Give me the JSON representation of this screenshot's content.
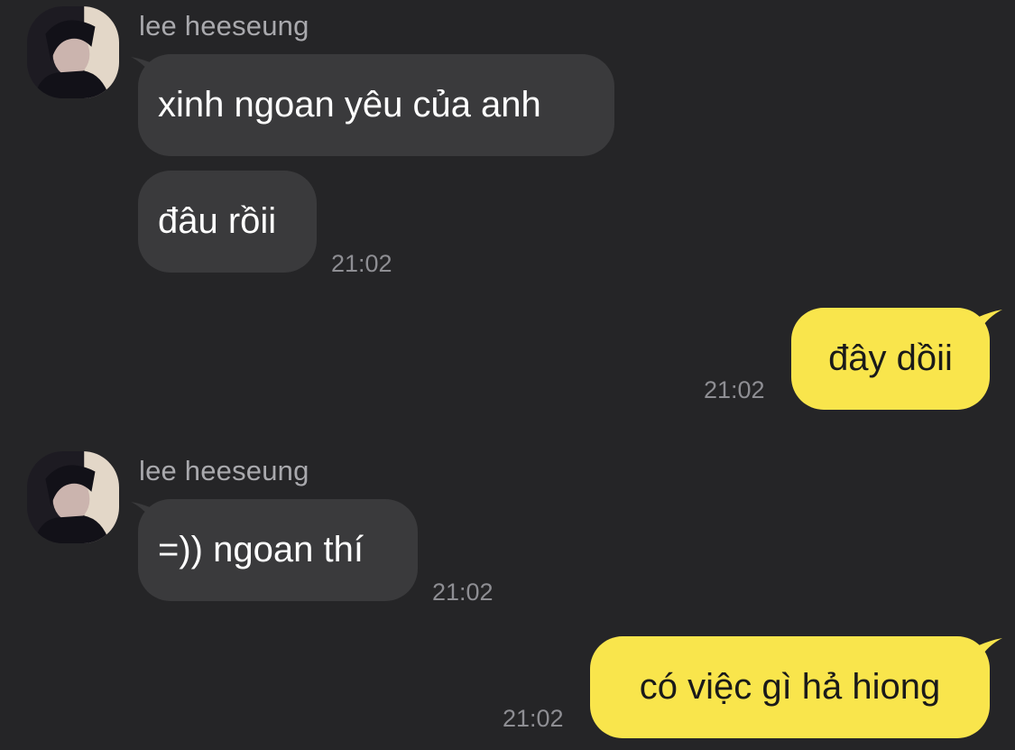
{
  "messages": [
    {
      "sender_name": "lee heeseung",
      "avatar_icon": "profile-photo-icon",
      "bubbles": [
        {
          "text": "xinh ngoan yêu của anh"
        },
        {
          "text": "đâu rồii",
          "time": "21:02"
        }
      ]
    },
    {
      "outgoing": true,
      "bubbles": [
        {
          "text": "đây dồii",
          "time": "21:02"
        }
      ]
    },
    {
      "sender_name": "lee heeseung",
      "avatar_icon": "profile-photo-icon",
      "bubbles": [
        {
          "text": "=)) ngoan thí",
          "time": "21:02"
        }
      ]
    },
    {
      "outgoing": true,
      "bubbles": [
        {
          "text": "có việc gì hả hiong",
          "time": "21:02"
        }
      ]
    }
  ],
  "colors": {
    "background": "#252527",
    "incoming_bubble": "#3a3a3c",
    "outgoing_bubble": "#f9e54c",
    "sender_name": "#a9a9ad",
    "timestamp": "#8e8e93"
  }
}
